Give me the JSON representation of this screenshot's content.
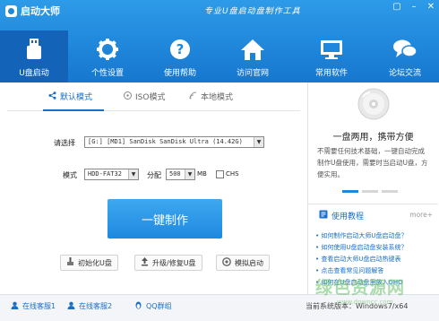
{
  "app": {
    "title": "启动大师",
    "slogan": "专业U盘启动盘制作工具"
  },
  "window_buttons": [
    "restore",
    "minimize",
    "close"
  ],
  "colors": {
    "header": "#1e88df",
    "active_nav": "#1364b8",
    "accent": "#1a6fc9",
    "watermark": "#68c06a"
  },
  "nav": {
    "items": [
      {
        "label": "U盘启动",
        "icon": "usb-icon",
        "active": true
      },
      {
        "label": "个性设置",
        "icon": "gear-icon",
        "active": false
      },
      {
        "label": "使用帮助",
        "icon": "question-icon",
        "active": false
      },
      {
        "label": "访问官网",
        "icon": "home-icon",
        "active": false
      },
      {
        "label": "常用软件",
        "icon": "monitor-icon",
        "active": false
      },
      {
        "label": "论坛交流",
        "icon": "chat-icon",
        "active": false
      }
    ]
  },
  "tabs": [
    {
      "label": "默认模式",
      "active": true
    },
    {
      "label": "ISO模式",
      "active": false
    },
    {
      "label": "本地模式",
      "active": false
    }
  ],
  "form": {
    "select_label": "请选择",
    "device_value": "[G:] [MD1] SanDisk SanDisk Ultra (14.42G)",
    "mode_label": "模式",
    "mode_value": "HDD-FAT32",
    "partition_label": "分配",
    "partition_value": "500",
    "partition_unit": "MB",
    "chs_label": "CHS"
  },
  "actions": {
    "make": "一键制作",
    "init": "初始化U盘",
    "upgrade": "升级/修复U盘",
    "simulate": "模拟启动"
  },
  "promo": {
    "title": "一盘两用，携带方便",
    "text": "不需要任何技术基础，一键自动完成制作U盘使用，需要时当启动U盘，方便实用。"
  },
  "guide": {
    "title": "使用教程",
    "more": "more+",
    "items": [
      "如何制作启动大师U盘启动盘？",
      "如何使用U盘启动盘安装系统？",
      "查看启动大师U盘启动热键表",
      "点击查看常见问题解答",
      "如何在U盘启动盘里放入GHO"
    ]
  },
  "bottom": {
    "links": [
      "在线客服1",
      "在线客服2",
      "QQ群组"
    ],
    "version": "当前系统版本：Windows7/x64"
  },
  "watermark": {
    "text": "绿色资源网",
    "url": "www.downcc.com"
  }
}
